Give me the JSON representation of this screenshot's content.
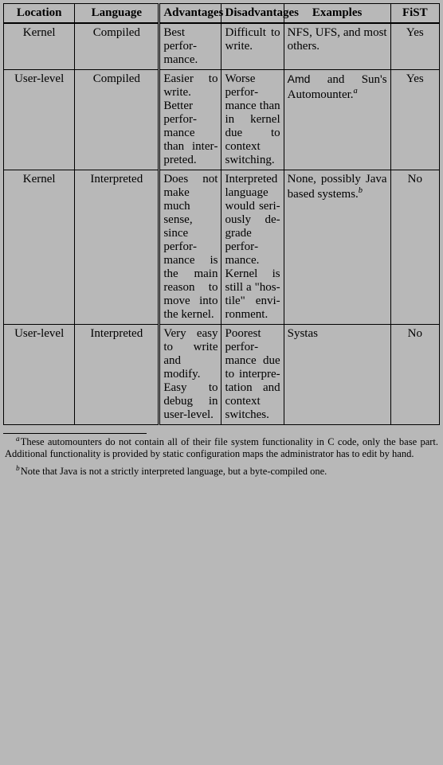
{
  "headers": {
    "location": "Location",
    "language": "Language",
    "advantages": "Advantages",
    "disadvantages": "Disadvantages",
    "examples": "Examples",
    "fist": "FiST"
  },
  "rows": [
    {
      "location": "Kernel",
      "language": "Compiled",
      "advantages": "Best perfor­mance.",
      "disadvantages": "Difficult to write.",
      "examples": "NFS, UFS, and most others.",
      "fist": "Yes"
    },
    {
      "location": "User-level",
      "language": "Compiled",
      "advantages": "Easier to write. Better perfor­mance than inter­preted.",
      "disadvantages": "Worse perfor­mance than in kernel due to context switch­ing.",
      "examples_pre": "",
      "examples_amd": "Amd",
      "examples_post": " and Sun's Automounter.",
      "examples_sup": "a",
      "fist": "Yes"
    },
    {
      "location": "Kernel",
      "language": "Interpreted",
      "advantages": "Does not make much sense, since perfor­mance is the main rea­son to move into the kernel.",
      "disadvantages": "Interpreted lan­guage would seri­ously de­grade perfor­mance. Kernel is still a \"hos­tile\" envi­ron­ment.",
      "examples": "None, possibly Java based sys­tems.",
      "examples_sup": "b",
      "fist": "No"
    },
    {
      "location": "User-level",
      "language": "Interpreted",
      "advantages": "Very easy to write and modify. Easy to debug in user-level.",
      "disadvantages": "Poorest perfor­mance due to inter­pre­tation and context switches.",
      "examples": "Systas",
      "fist": "No"
    }
  ],
  "footnotes": {
    "a": "These automounters do not contain all of their file system functionality in C code, only the base part. Additional functionality is provided by static configuration maps the administrator has to edit by hand.",
    "b": "Note that Java is not a strictly interpreted language, but a byte-compiled one."
  }
}
